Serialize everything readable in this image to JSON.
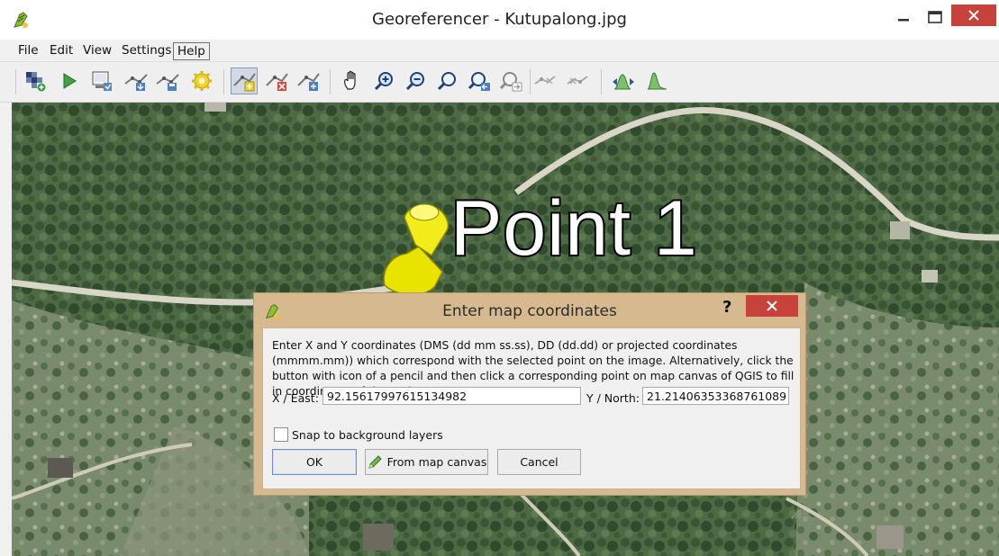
{
  "window": {
    "title": "Georeferencer - Kutupalong.jpg"
  },
  "menu": {
    "file": "File",
    "edit": "Edit",
    "view": "View",
    "settings": "Settings",
    "help": "Help"
  },
  "toolbar": {
    "icons": [
      "open-raster-icon",
      "start-georeferencing-icon",
      "generate-gdal-script-icon",
      "load-gcp-points-icon",
      "save-gcp-points-icon",
      "transformation-settings-icon",
      "add-point-icon",
      "delete-point-icon",
      "move-gcp-point-icon",
      "pan-icon",
      "zoom-in-icon",
      "zoom-out-icon",
      "zoom-to-layer-icon",
      "zoom-last-icon",
      "zoom-next-icon",
      "link-georeferencer-to-qgis-icon",
      "link-qgis-to-georeferencer-icon",
      "full-histogram-stretch-icon",
      "local-histogram-stretch-icon"
    ]
  },
  "canvas": {
    "overlay_text": "Point 1"
  },
  "dialog": {
    "title": "Enter map coordinates",
    "help_glyph": "?",
    "description": "Enter X and Y coordinates (DMS (dd mm ss.ss), DD (dd.dd) or projected coordinates (mmmm.mm)) which correspond with the selected point on the image. Alternatively, click the button with icon of a pencil and then click a corresponding point on map canvas of QGIS to fill in coordinates of that point.",
    "x_label": "X / East:",
    "x_value": "92.15617997615134982",
    "y_label": "Y / North:",
    "y_value": "21.21406353368761089",
    "snap_label": "Snap to background layers",
    "snap_checked": false,
    "ok_label": "OK",
    "from_map_label": "From map canvas",
    "cancel_label": "Cancel"
  },
  "colors": {
    "close_red": "#c7423a",
    "dialog_frame": "#d6b98e"
  }
}
